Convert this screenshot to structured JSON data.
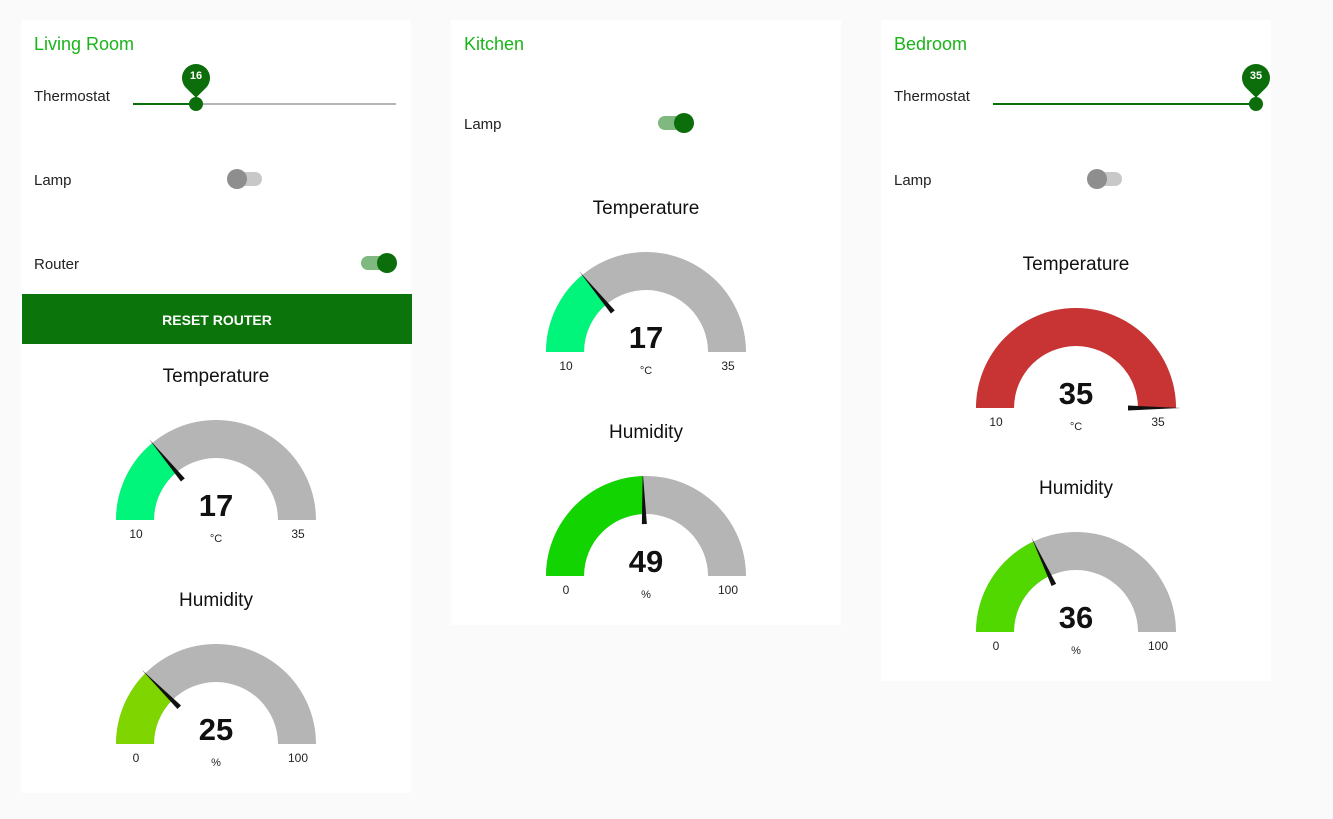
{
  "rooms": [
    {
      "title": "Living Room",
      "thermostat": {
        "label": "Thermostat",
        "value": "16",
        "min": 10,
        "max": 35
      },
      "lamp": {
        "label": "Lamp",
        "on": false
      },
      "router": {
        "label": "Router",
        "on": true
      },
      "reset_label": "RESET ROUTER",
      "temperature": {
        "title": "Temperature",
        "value": "17",
        "unit": "°C",
        "min": "10",
        "max": "35",
        "color": "#00f57a"
      },
      "humidity": {
        "title": "Humidity",
        "value": "25",
        "unit": "%",
        "min": "0",
        "max": "100",
        "color": "#7ed500"
      }
    },
    {
      "title": "Kitchen",
      "lamp": {
        "label": "Lamp",
        "on": true
      },
      "temperature": {
        "title": "Temperature",
        "value": "17",
        "unit": "°C",
        "min": "10",
        "max": "35",
        "color": "#00f57a"
      },
      "humidity": {
        "title": "Humidity",
        "value": "49",
        "unit": "%",
        "min": "0",
        "max": "100",
        "color": "#12d400"
      }
    },
    {
      "title": "Bedroom",
      "thermostat": {
        "label": "Thermostat",
        "value": "35",
        "min": 10,
        "max": 35
      },
      "lamp": {
        "label": "Lamp",
        "on": false
      },
      "temperature": {
        "title": "Temperature",
        "value": "35",
        "unit": "°C",
        "min": "10",
        "max": "35",
        "color": "#c83333"
      },
      "humidity": {
        "title": "Humidity",
        "value": "36",
        "unit": "%",
        "min": "0",
        "max": "100",
        "color": "#50d800"
      }
    }
  ],
  "colors": {
    "accent": "#0b6e0b",
    "title": "#1ab31a",
    "track": "#b5b5b5",
    "gauge_bg": "#b5b5b5"
  }
}
